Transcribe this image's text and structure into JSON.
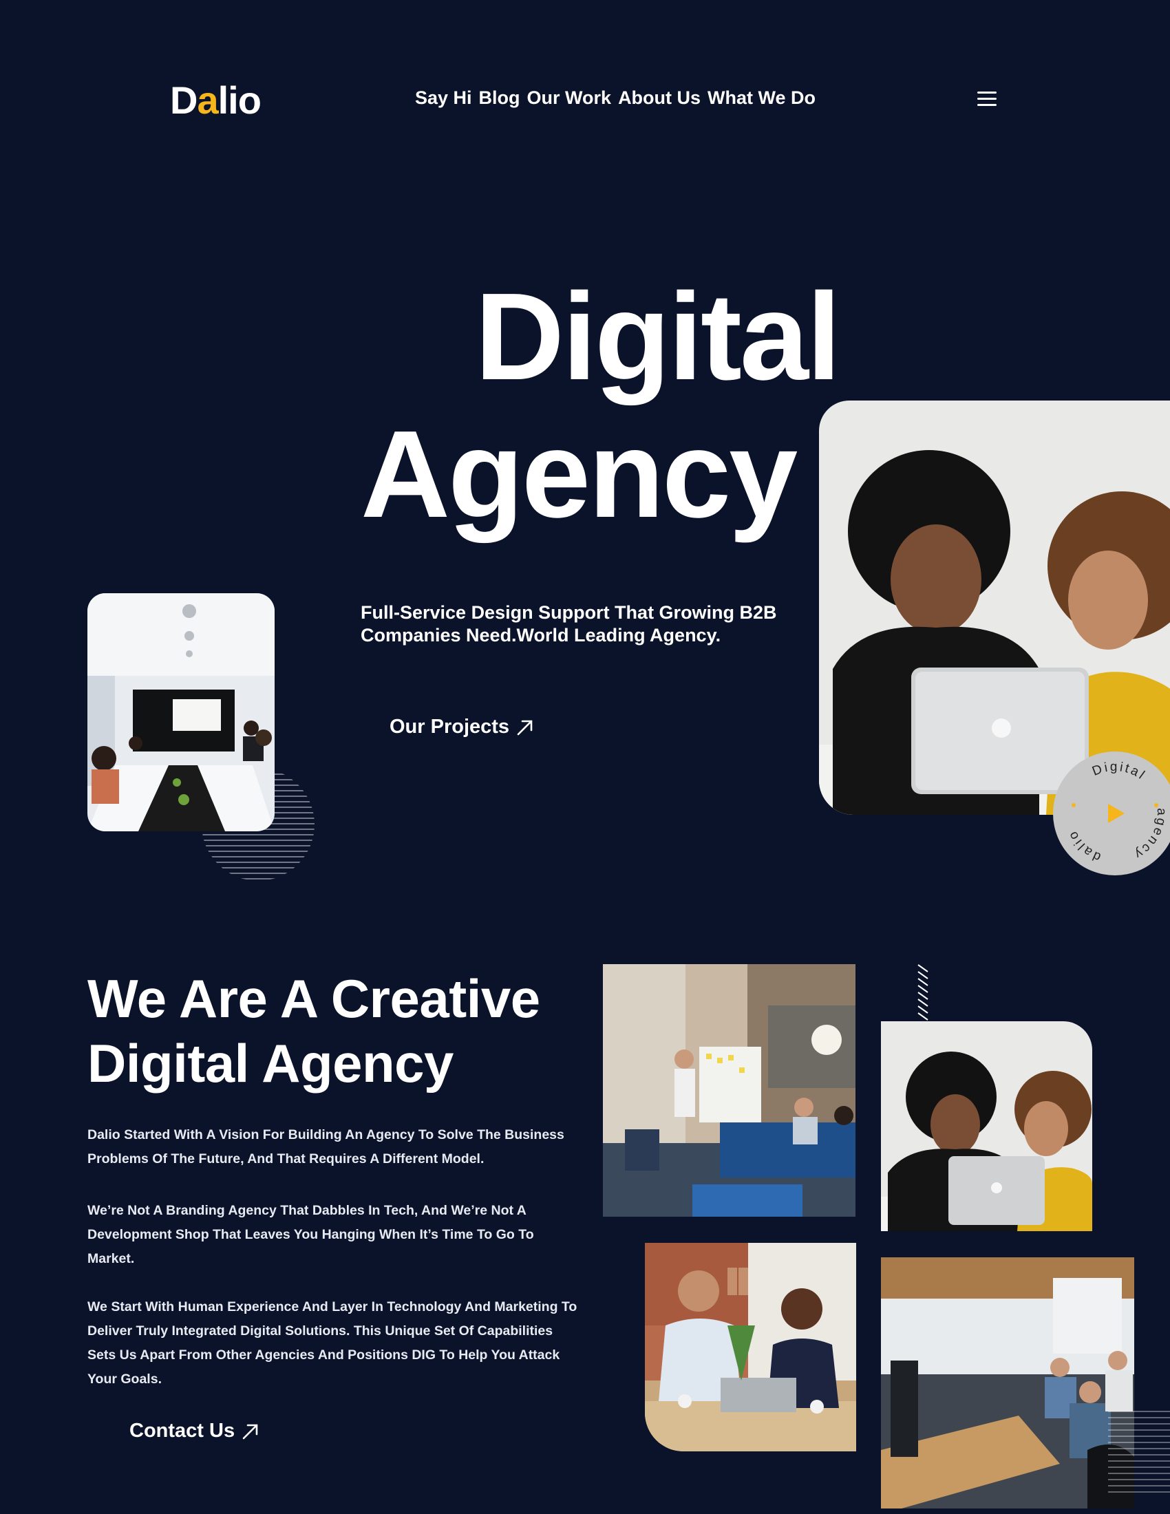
{
  "header": {
    "logo_prefix": "D",
    "logo_accent": "a",
    "logo_suffix": "lio",
    "nav": [
      "Say Hi",
      "Blog",
      "Our Work",
      "About Us",
      "What We Do"
    ]
  },
  "hero": {
    "title_line1": "Digital",
    "title_line2": "Agency",
    "subtitle": "Full-Service Design Support That Growing B2B Companies Need.World Leading Agency.",
    "cta_label": "Our Projects",
    "badge": {
      "top_text": "Digital",
      "right_text": "agency",
      "left_text": "dalio"
    }
  },
  "about": {
    "title_line1": "We Are A Creative",
    "title_line2": "Digital Agency",
    "paragraph1": "Dalio Started With A Vision For Building An Agency To Solve The Business Problems Of The Future, And That Requires A Different Model.",
    "paragraph2": "We’re Not A Branding Agency That Dabbles In Tech, And We’re Not A Development Shop That Leaves You Hanging When It’s Time To Go To Market.",
    "paragraph3": "We Start With Human Experience And Layer In Technology And Marketing To Deliver Truly Integrated Digital Solutions. This Unique Set Of Capabilities Sets Us Apart From Other Agencies And Positions DIG To Help You Attack Your Goals.",
    "cta_label": "Contact Us"
  },
  "colors": {
    "background": "#0b132b",
    "accent": "#f6b51c",
    "text": "#ffffff"
  },
  "icons": {
    "menu": "hamburger-menu-icon",
    "arrow": "arrow-up-right-icon",
    "play": "play-icon"
  }
}
